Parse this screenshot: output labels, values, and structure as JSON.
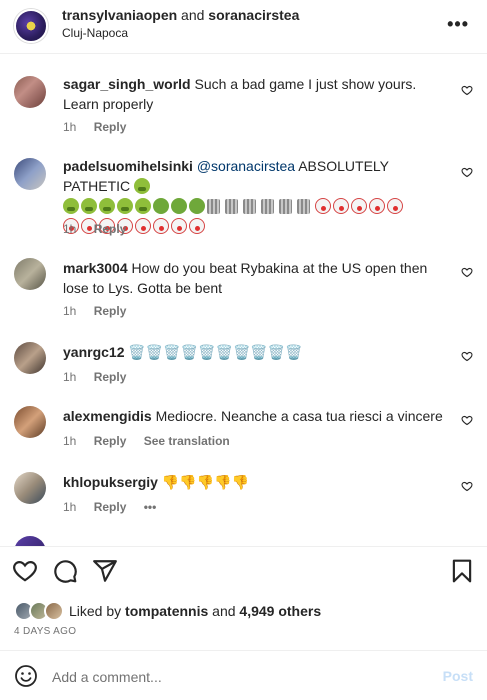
{
  "header": {
    "account_main": "transylvaniaopen",
    "and_word": "and",
    "account_collab": "soranacirstea",
    "location": "Cluj-Napoca",
    "more_icon": "more-horizontal-icon"
  },
  "comments": [
    {
      "username": "sagar_singh_world",
      "text": "Such a bad game I just show yours. Learn properly",
      "time": "1h",
      "reply": "Reply"
    },
    {
      "username": "padelsuomihelsinki",
      "mention": "@soranacirstea",
      "text": "ABSOLUTELY PATHETIC",
      "emoji_sick": "🤮",
      "emoji_nauseated": "🤢",
      "emoji_trash": "🗑️",
      "emoji_clown": "🤡",
      "time": "1h",
      "reply": "Reply"
    },
    {
      "username": "mark3004",
      "text": "How do you beat Rybakina at the US open then lose to Lys. Gotta be bent",
      "time": "1h",
      "reply": "Reply"
    },
    {
      "username": "yanrgc12",
      "text": "🗑️🗑️🗑️🗑️🗑️🗑️🗑️🗑️🗑️🗑️",
      "time": "1h",
      "reply": "Reply"
    },
    {
      "username": "alexmengidis",
      "text": "Mediocre. Neanche a casa tua riesci a vincere",
      "time": "1h",
      "reply": "Reply",
      "see_translation": "See translation"
    },
    {
      "username": "khlopuksergiy",
      "text": "👎👎👎👎👎",
      "time": "1h",
      "reply": "Reply",
      "more": "•••"
    }
  ],
  "likes": {
    "prefix": "Liked by",
    "user": "tompatennis",
    "and_word": "and",
    "others": "4,949 others"
  },
  "date": "4 DAYS AGO",
  "composer": {
    "placeholder": "Add a comment...",
    "post_label": "Post"
  },
  "colors": {
    "text": "#262626",
    "secondary": "#737373",
    "link": "#00376b",
    "post_disabled": "#c7dff7"
  }
}
